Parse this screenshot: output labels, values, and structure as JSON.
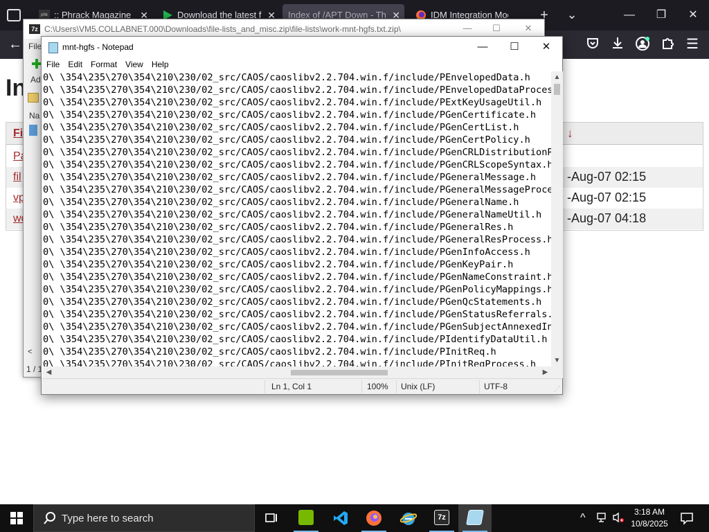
{
  "firefox": {
    "tabs": [
      {
        "title": ":: Phrack Magazine ::"
      },
      {
        "title": "Download the latest fr"
      },
      {
        "title": "Index of /APT Down - The"
      },
      {
        "title": "IDM Integration Modul"
      }
    ],
    "new_tab": "+",
    "tab_list": "⌄",
    "page": {
      "title": "In",
      "header_col1": "Fi",
      "header_sort": "↓",
      "rows": [
        {
          "name": "Pa",
          "date": ""
        },
        {
          "name": "fil",
          "date": "-Aug-07 02:15"
        },
        {
          "name": "vp",
          "date": "-Aug-07 02:15"
        },
        {
          "name": "wo",
          "date": "-Aug-07 04:18"
        }
      ]
    }
  },
  "sevenzip": {
    "title": "C:\\Users\\VM5.COLLABNET.000\\Downloads\\file-lists_and_misc.zip\\file-lists\\work-mnt-hgfs.txt.zip\\",
    "logo": "7z",
    "menu_peek": "File",
    "add_peek": "Ad",
    "name_col_peek": "Na",
    "status_peek": "1 / 1",
    "scroll_left": "<"
  },
  "notepad": {
    "title": "mnt-hgfs - Notepad",
    "controls": {
      "minimize": "—",
      "maximize": "☐",
      "close": "✕"
    },
    "menu": [
      "File",
      "Edit",
      "Format",
      "View",
      "Help"
    ],
    "lines": [
      "0\\ \\354\\235\\270\\354\\210\\230/02_src/CAOS/caoslibv2.2.704.win.f/include/PEnvelopedData.h",
      "0\\ \\354\\235\\270\\354\\210\\230/02_src/CAOS/caoslibv2.2.704.win.f/include/PEnvelopedDataProcess",
      "0\\ \\354\\235\\270\\354\\210\\230/02_src/CAOS/caoslibv2.2.704.win.f/include/PExtKeyUsageUtil.h",
      "0\\ \\354\\235\\270\\354\\210\\230/02_src/CAOS/caoslibv2.2.704.win.f/include/PGenCertificate.h",
      "0\\ \\354\\235\\270\\354\\210\\230/02_src/CAOS/caoslibv2.2.704.win.f/include/PGenCertList.h",
      "0\\ \\354\\235\\270\\354\\210\\230/02_src/CAOS/caoslibv2.2.704.win.f/include/PGenCertPolicy.h",
      "0\\ \\354\\235\\270\\354\\210\\230/02_src/CAOS/caoslibv2.2.704.win.f/include/PGenCRLDistributionPoi",
      "0\\ \\354\\235\\270\\354\\210\\230/02_src/CAOS/caoslibv2.2.704.win.f/include/PGenCRLScopeSyntax.h",
      "0\\ \\354\\235\\270\\354\\210\\230/02_src/CAOS/caoslibv2.2.704.win.f/include/PGeneralMessage.h",
      "0\\ \\354\\235\\270\\354\\210\\230/02_src/CAOS/caoslibv2.2.704.win.f/include/PGeneralMessageProces:",
      "0\\ \\354\\235\\270\\354\\210\\230/02_src/CAOS/caoslibv2.2.704.win.f/include/PGeneralName.h",
      "0\\ \\354\\235\\270\\354\\210\\230/02_src/CAOS/caoslibv2.2.704.win.f/include/PGeneralNameUtil.h",
      "0\\ \\354\\235\\270\\354\\210\\230/02_src/CAOS/caoslibv2.2.704.win.f/include/PGeneralRes.h",
      "0\\ \\354\\235\\270\\354\\210\\230/02_src/CAOS/caoslibv2.2.704.win.f/include/PGeneralResProcess.h",
      "0\\ \\354\\235\\270\\354\\210\\230/02_src/CAOS/caoslibv2.2.704.win.f/include/PGenInfoAccess.h",
      "0\\ \\354\\235\\270\\354\\210\\230/02_src/CAOS/caoslibv2.2.704.win.f/include/PGenKeyPair.h",
      "0\\ \\354\\235\\270\\354\\210\\230/02_src/CAOS/caoslibv2.2.704.win.f/include/PGenNameConstraint.h",
      "0\\ \\354\\235\\270\\354\\210\\230/02_src/CAOS/caoslibv2.2.704.win.f/include/PGenPolicyMappings.h",
      "0\\ \\354\\235\\270\\354\\210\\230/02_src/CAOS/caoslibv2.2.704.win.f/include/PGenQcStatements.h",
      "0\\ \\354\\235\\270\\354\\210\\230/02_src/CAOS/caoslibv2.2.704.win.f/include/PGenStatusReferrals.h",
      "0\\ \\354\\235\\270\\354\\210\\230/02_src/CAOS/caoslibv2.2.704.win.f/include/PGenSubjectAnnexedInfo",
      "0\\ \\354\\235\\270\\354\\210\\230/02_src/CAOS/caoslibv2.2.704.win.f/include/PIdentifyDataUtil.h",
      "0\\ \\354\\235\\270\\354\\210\\230/02_src/CAOS/caoslibv2.2.704.win.f/include/PInitReq.h",
      "0\\ \\354\\235\\270\\354\\210\\230/02_src/CAOS/caoslibv2.2.704.win.f/include/PInitReqProcess.h"
    ],
    "status": {
      "position": "Ln 1, Col 1",
      "zoom": "100%",
      "line_ending": "Unix (LF)",
      "encoding": "UTF-8"
    }
  },
  "taskbar": {
    "search_placeholder": "Type here to search",
    "apps": [
      {
        "name": "Task View",
        "icon": "task-view-icon",
        "color": "#ffffff"
      },
      {
        "name": "NVIDIA",
        "icon": "nvidia-icon",
        "color": "#76b900"
      },
      {
        "name": "Visual Studio Code",
        "icon": "vscode-icon",
        "color": "#23a9f2"
      },
      {
        "name": "Firefox",
        "icon": "firefox-icon",
        "color": "#ff7139"
      },
      {
        "name": "Internet Explorer",
        "icon": "ie-icon",
        "color": "#3aa5e0"
      },
      {
        "name": "7-Zip",
        "icon": "sevenzip-icon",
        "color": "#2b2b2b"
      },
      {
        "name": "Notepad",
        "icon": "notepad-icon",
        "color": "#a8d8f0"
      }
    ],
    "clock": {
      "time": "3:18 AM",
      "date": "10/8/2025"
    },
    "tray_chevron": "^",
    "accent": "#76b9ed"
  }
}
